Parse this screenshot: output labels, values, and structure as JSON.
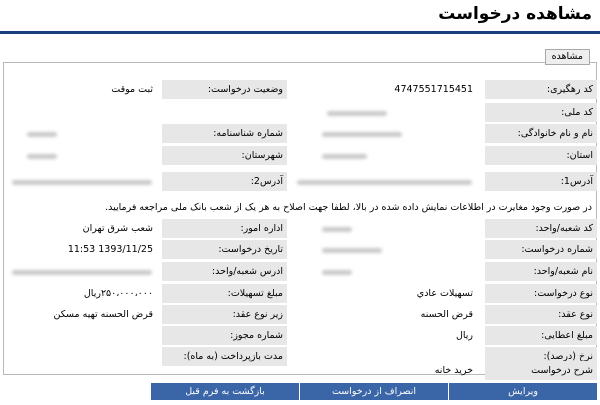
{
  "page": {
    "title": "مشاهده درخواست",
    "tab_label": "مشاهده"
  },
  "fields": {
    "tracking_code_label": "کد رهگیری:",
    "tracking_code": "4747551715451",
    "status_label": "وضعیت درخواست:",
    "status": "ثبت موقت",
    "national_id_label": "کد ملی:",
    "name_label": "نام و نام خانوادگی:",
    "id_number_label": "شماره شناسنامه:",
    "province_label": "استان:",
    "city_label": "شهرستان:",
    "address1_label": "آدرس1:",
    "address2_label": "آدرس2:",
    "note": "در صورت وجود مغایرت در اطلاعات نمایش داده شده در بالا، لطفا جهت اصلاح به هر یک از شعب بانک ملی مراجعه فرمایید.",
    "branch_code_label": "کد شعبه/واحد:",
    "affairs_label": "اداره امور:",
    "affairs": "شعب شرق تهران",
    "request_number_label": "شماره درخواست:",
    "request_date_label": "تاریخ درخواست:",
    "request_date": "1393/11/25 11:53",
    "branch_name_label": "نام شعبه/واحد:",
    "branch_address_label": "ادرس شعبه/واحد:",
    "request_type_label": "نوع درخواست:",
    "request_type": "تسهیلات عادي",
    "amount_label": "مبلغ تسهیلات:",
    "amount": "۲۵۰،۰۰۰،۰۰۰ریال",
    "contract_type_label": "نوع عقد:",
    "contract_type": "قرض الحسنه",
    "sub_contract_label": "زیر نوع عقد:",
    "sub_contract": "قرض الحسنه تهیه مسکن",
    "granted_amount_label": "مبلغ اعطایی:",
    "granted_amount": "ریال",
    "permit_number_label": "شماره مجوز:",
    "rate_label": "نرخ (درصد):",
    "repayment_label": "مدت بازپرداخت (به ماه):",
    "description_label": "شرح درخواست",
    "description": "خرید خانه"
  },
  "buttons": {
    "edit": "ویرایش",
    "cancel": "انصراف از درخواست",
    "back": "بازگشت به فرم قبل"
  },
  "colors": {
    "title_rule": "#1a3f7a",
    "button_bg": "#3a66a8",
    "label_bg": "#e7e7e7"
  }
}
